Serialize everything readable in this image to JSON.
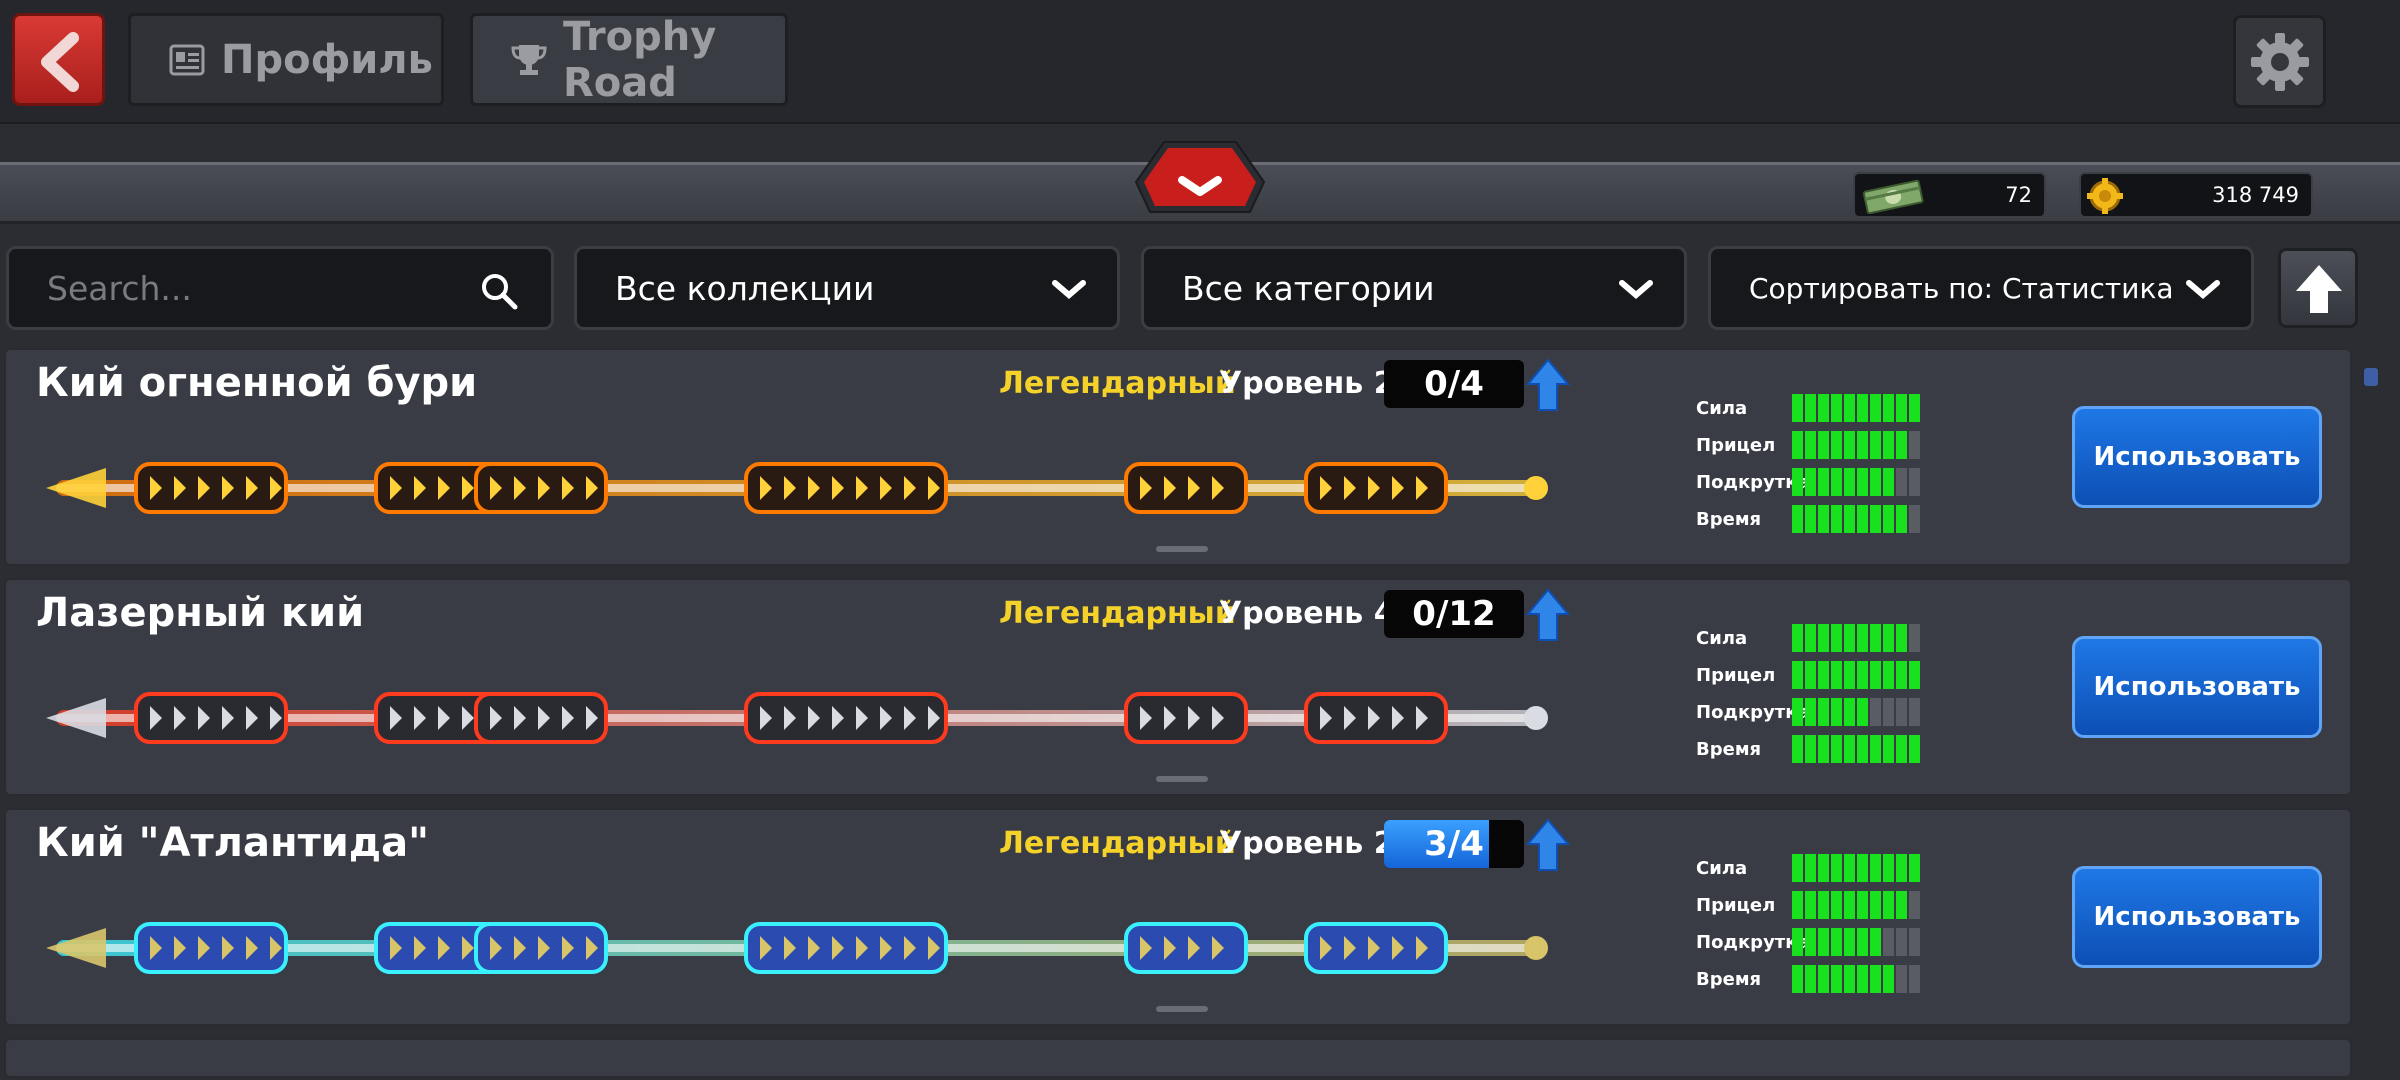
{
  "topbar": {
    "back_icon": "back-arrow-icon",
    "tabs": [
      {
        "label": "Профиль",
        "icon": "profile-card-icon"
      },
      {
        "label": "Trophy Road",
        "icon": "trophy-icon"
      }
    ],
    "settings_icon": "gear-icon"
  },
  "currency": {
    "cash": "72",
    "coins": "318 749"
  },
  "filters": {
    "search_placeholder": "Search...",
    "collections": "Все коллекции",
    "categories": "Все категории",
    "sort": "Сортировать по: Статистика"
  },
  "stat_labels": [
    "Сила",
    "Прицел",
    "Подкрутка",
    "Время"
  ],
  "cues": [
    {
      "name": "Кий огненной бури",
      "rarity": "Легендарный",
      "level": "Уровень 2",
      "progress": "0/4",
      "progress_fraction": 0,
      "stats": [
        10,
        9,
        8,
        9
      ],
      "button": "Использовать",
      "colors": [
        "#ff7a00",
        "#ffd23a",
        "#2a1b12"
      ]
    },
    {
      "name": "Лазерный кий",
      "rarity": "Легендарный",
      "level": "Уровень 4",
      "progress": "0/12",
      "progress_fraction": 0,
      "stats": [
        9,
        10,
        6,
        10
      ],
      "button": "Использовать",
      "colors": [
        "#ff3b1f",
        "#d9dce2",
        "#2a2b30"
      ]
    },
    {
      "name": "Кий \"Атлантида\"",
      "rarity": "Легендарный",
      "level": "Уровень 2",
      "progress": "3/4",
      "progress_fraction": 0.75,
      "stats": [
        10,
        9,
        7,
        8
      ],
      "button": "Использовать",
      "colors": [
        "#39f0ff",
        "#d8c56a",
        "#2b4bb0"
      ]
    }
  ],
  "theme": {
    "accent_yellow": "#f4d22a",
    "stat_green": "#17e21d",
    "button_blue": "#1565d8",
    "back_red": "#c9302c"
  }
}
